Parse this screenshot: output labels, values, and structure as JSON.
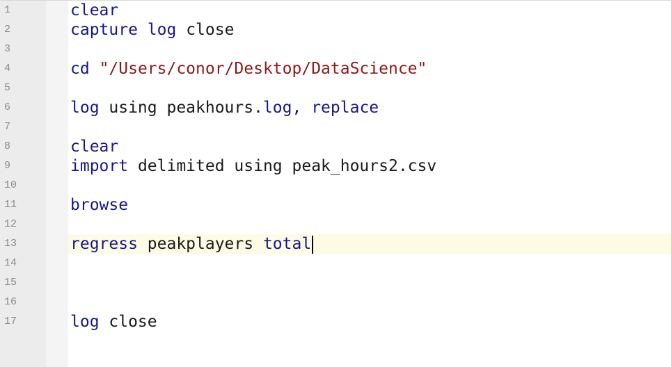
{
  "editor": {
    "line_numbers": [
      "1",
      "2",
      "3",
      "4",
      "5",
      "6",
      "7",
      "8",
      "9",
      "10",
      "11",
      "12",
      "13",
      "14",
      "15",
      "16",
      "17"
    ],
    "current_line": 13,
    "lines": [
      {
        "n": 1,
        "tokens": [
          {
            "t": "kw",
            "v": "clear"
          }
        ]
      },
      {
        "n": 2,
        "tokens": [
          {
            "t": "kw",
            "v": "capture"
          },
          {
            "t": "plain",
            "v": " "
          },
          {
            "t": "kw",
            "v": "log"
          },
          {
            "t": "plain",
            "v": " close"
          }
        ]
      },
      {
        "n": 3,
        "tokens": []
      },
      {
        "n": 4,
        "tokens": [
          {
            "t": "kw",
            "v": "cd"
          },
          {
            "t": "plain",
            "v": " "
          },
          {
            "t": "str",
            "v": "\"/Users/conor/Desktop/DataScience\""
          }
        ]
      },
      {
        "n": 5,
        "tokens": []
      },
      {
        "n": 6,
        "tokens": [
          {
            "t": "kw",
            "v": "log"
          },
          {
            "t": "plain",
            "v": " using peakhours."
          },
          {
            "t": "kw",
            "v": "log"
          },
          {
            "t": "plain",
            "v": ", "
          },
          {
            "t": "kw",
            "v": "replace"
          }
        ]
      },
      {
        "n": 7,
        "tokens": []
      },
      {
        "n": 8,
        "tokens": [
          {
            "t": "kw",
            "v": "clear"
          }
        ]
      },
      {
        "n": 9,
        "tokens": [
          {
            "t": "kw",
            "v": "import"
          },
          {
            "t": "plain",
            "v": " delimited using peak_hours2.csv"
          }
        ]
      },
      {
        "n": 10,
        "tokens": []
      },
      {
        "n": 11,
        "tokens": [
          {
            "t": "kw",
            "v": "browse"
          }
        ]
      },
      {
        "n": 12,
        "tokens": []
      },
      {
        "n": 13,
        "tokens": [
          {
            "t": "kw",
            "v": "regress"
          },
          {
            "t": "plain",
            "v": " peakplayers "
          },
          {
            "t": "kw",
            "v": "total"
          }
        ]
      },
      {
        "n": 14,
        "tokens": []
      },
      {
        "n": 15,
        "tokens": []
      },
      {
        "n": 16,
        "tokens": []
      },
      {
        "n": 17,
        "tokens": [
          {
            "t": "kw",
            "v": "log"
          },
          {
            "t": "plain",
            "v": " close"
          }
        ]
      }
    ],
    "colors": {
      "keyword": "#16168f",
      "plain": "#1a1a1a",
      "string": "#8b1a1a",
      "current_line_bg": "#fdfbe3",
      "gutter_bg": "#ececec"
    }
  }
}
